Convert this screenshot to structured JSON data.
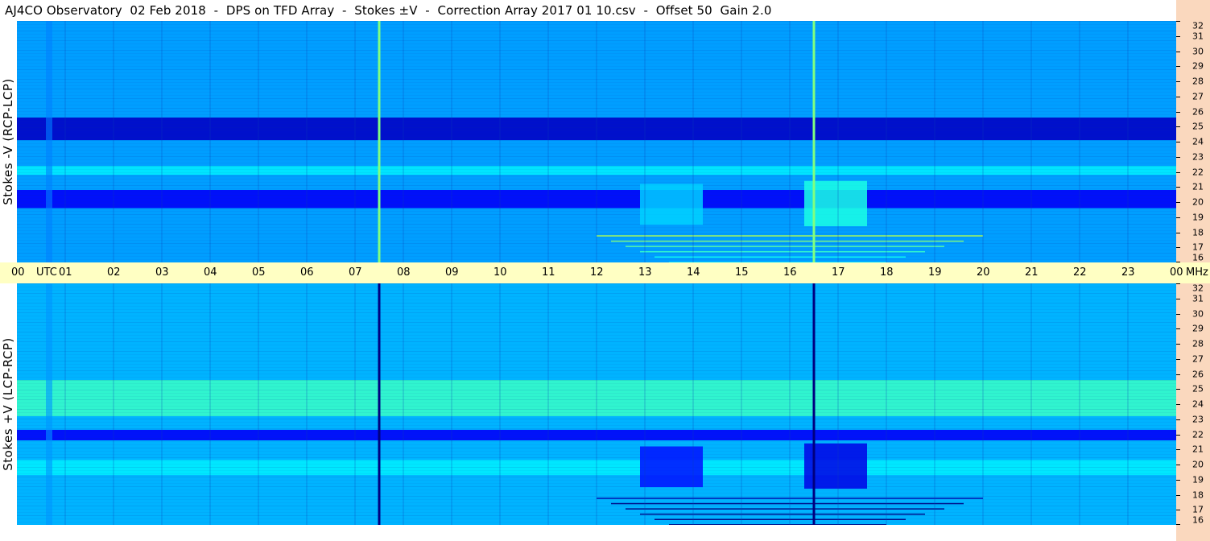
{
  "title": "AJ4CO Observatory  02 Feb 2018  -  DPS on TFD Array  -  Stokes ±V  -  Correction Array 2017 01 10.csv  -  Offset 50  Gain 2.0",
  "colors": {
    "background": "#1f64e4",
    "time_axis_bg": "#ffffc3",
    "freq_axis_bg": "#fad8be"
  },
  "chart_data": [
    {
      "type": "heatmap",
      "panel": "top",
      "ylabel": "Stokes -V (RCP-LCP)",
      "y_unit": "MHz",
      "ylim": [
        16,
        32
      ],
      "y_ticks": [
        "32",
        "31",
        "30",
        "29",
        "28",
        "27",
        "26",
        "25",
        "24",
        "23",
        "22",
        "21",
        "20",
        "19",
        "18",
        "17",
        "16"
      ],
      "x_unit": "UTC",
      "xlim": [
        0,
        24
      ],
      "x_ticks": [
        "00",
        "01",
        "02",
        "03",
        "04",
        "05",
        "06",
        "07",
        "08",
        "09",
        "10",
        "11",
        "12",
        "13",
        "14",
        "15",
        "16",
        "17",
        "18",
        "19",
        "20",
        "21",
        "22",
        "23",
        "00"
      ],
      "colormap": "jet",
      "features": {
        "dark_bands": [
          {
            "f0": 24.1,
            "f1": 25.6,
            "level": 0.07
          },
          {
            "f0": 19.6,
            "f1": 20.8,
            "level": 0.12
          }
        ],
        "bright_bands": [
          {
            "f0": 21.8,
            "f1": 22.4,
            "level": 0.36
          }
        ],
        "vertical_lines": [
          {
            "t": 7.5,
            "level": 0.5
          },
          {
            "t": 16.5,
            "level": 0.5
          }
        ],
        "bursts": [
          {
            "t0": 12.9,
            "t1": 14.2,
            "f0": 18.5,
            "f1": 21.2,
            "level": 0.33
          },
          {
            "t0": 16.3,
            "t1": 17.6,
            "f0": 18.4,
            "f1": 21.4,
            "level": 0.4
          }
        ],
        "interference": [
          {
            "t0": 12.0,
            "t1": 20.0,
            "f": 17.8,
            "level": 0.55
          }
        ]
      }
    },
    {
      "type": "heatmap",
      "panel": "bottom",
      "ylabel": "Stokes +V (LCP-RCP)",
      "y_unit": "MHz",
      "ylim": [
        16,
        32
      ],
      "y_ticks": [
        "32",
        "31",
        "30",
        "29",
        "28",
        "27",
        "26",
        "25",
        "24",
        "23",
        "22",
        "21",
        "20",
        "19",
        "18",
        "17",
        "16"
      ],
      "x_unit": "UTC",
      "xlim": [
        0,
        24
      ],
      "x_ticks": [
        "00",
        "01",
        "02",
        "03",
        "04",
        "05",
        "06",
        "07",
        "08",
        "09",
        "10",
        "11",
        "12",
        "13",
        "14",
        "15",
        "16",
        "17",
        "18",
        "19",
        "20",
        "21",
        "22",
        "23",
        "00"
      ],
      "colormap": "jet",
      "features": {
        "bright_bands": [
          {
            "f0": 23.2,
            "f1": 25.6,
            "level": 0.43
          },
          {
            "f0": 19.3,
            "f1": 20.3,
            "level": 0.36
          }
        ],
        "dark_bands": [
          {
            "f0": 21.6,
            "f1": 22.3,
            "level": 0.12
          }
        ],
        "vertical_lines": [
          {
            "t": 7.5,
            "level": 0.0
          },
          {
            "t": 16.5,
            "level": 0.0
          }
        ],
        "bursts": [
          {
            "t0": 12.9,
            "t1": 14.2,
            "f0": 18.5,
            "f1": 21.2,
            "level": 0.14
          },
          {
            "t0": 16.3,
            "t1": 17.6,
            "f0": 18.4,
            "f1": 21.4,
            "level": 0.1
          }
        ],
        "interference": [
          {
            "t0": 12.0,
            "t1": 20.0,
            "f": 17.8,
            "level": 0.04
          }
        ]
      }
    }
  ],
  "time_axis": {
    "labels": [
      "00",
      "UTC",
      "01",
      "02",
      "03",
      "04",
      "05",
      "06",
      "07",
      "08",
      "09",
      "10",
      "11",
      "12",
      "13",
      "14",
      "15",
      "16",
      "17",
      "18",
      "19",
      "20",
      "21",
      "22",
      "23",
      "00",
      "MHz"
    ]
  }
}
